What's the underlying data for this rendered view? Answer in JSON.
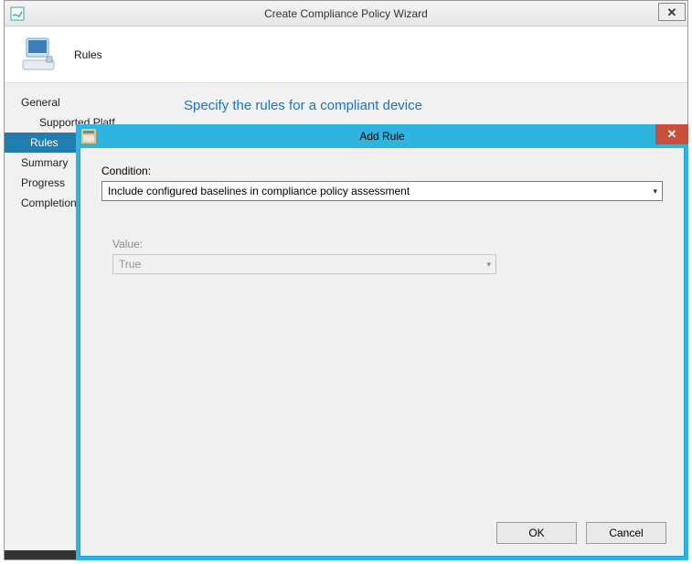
{
  "outer": {
    "title": "Create Compliance Policy Wizard",
    "close_glyph": "✕",
    "header_label": "Rules",
    "main_heading": "Specify the rules for a compliant device",
    "sidebar": [
      {
        "label": "General",
        "indent": false,
        "selected": false
      },
      {
        "label": "Supported Platf",
        "indent": true,
        "selected": false
      },
      {
        "label": "Rules",
        "indent": true,
        "selected": true
      },
      {
        "label": "Summary",
        "indent": false,
        "selected": false
      },
      {
        "label": "Progress",
        "indent": false,
        "selected": false
      },
      {
        "label": "Completion",
        "indent": false,
        "selected": false
      }
    ]
  },
  "dialog": {
    "title": "Add Rule",
    "close_glyph": "✕",
    "condition_label": "Condition:",
    "condition_value": "Include configured baselines in compliance policy assessment",
    "value_label": "Value:",
    "value_value": "True",
    "ok_label": "OK",
    "cancel_label": "Cancel"
  }
}
